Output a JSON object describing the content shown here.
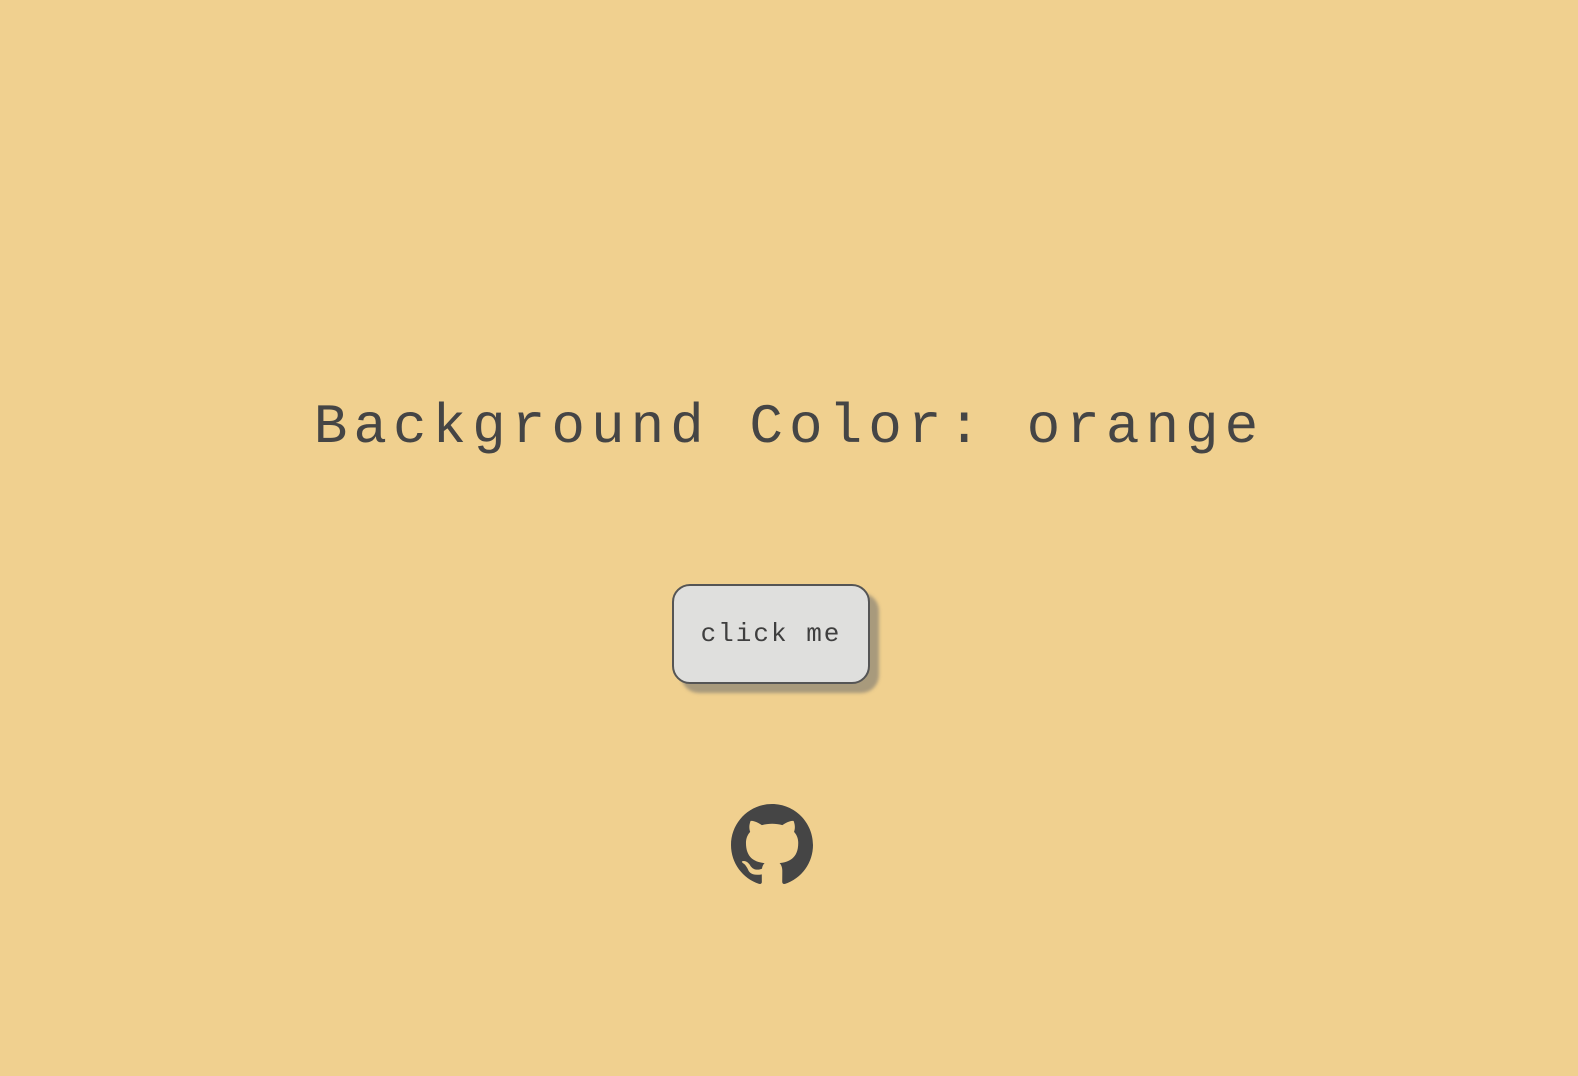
{
  "heading": {
    "text": "Background Color: orange"
  },
  "button": {
    "label": "click me"
  },
  "footer": {
    "icon": "github-icon"
  },
  "colors": {
    "background": "#f0d08f",
    "text": "#454545",
    "button_bg": "#dfdfdd"
  }
}
